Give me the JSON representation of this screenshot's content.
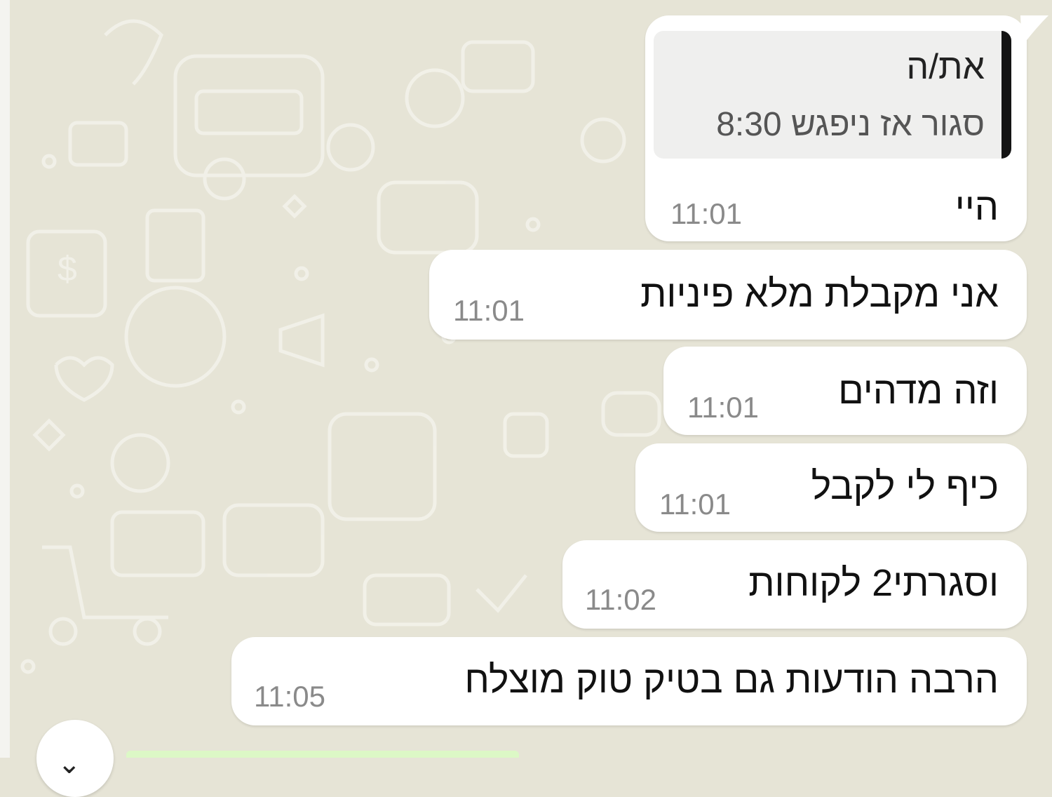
{
  "chat": {
    "reply": {
      "quoted_author": "את/ה",
      "quoted_text": "סגור אז ניפגש 8:30",
      "text": "היי",
      "time": "11:01"
    },
    "messages": [
      {
        "text": "אני מקבלת  מלא פיניות",
        "time": "11:01"
      },
      {
        "text": "וזה מדהים",
        "time": "11:01"
      },
      {
        "text": "כיף לי לקבל",
        "time": "11:01"
      },
      {
        "text": "וסגרתי2 לקוחות",
        "time": "11:02"
      },
      {
        "text": "הרבה הודעות גם בטיק טוק מוצלח",
        "time": "11:05"
      }
    ]
  },
  "colors": {
    "wallpaper": "#e6e4d6",
    "bubble": "#ffffff",
    "quote_bar": "#141414",
    "time_text": "#8a8a8a"
  }
}
